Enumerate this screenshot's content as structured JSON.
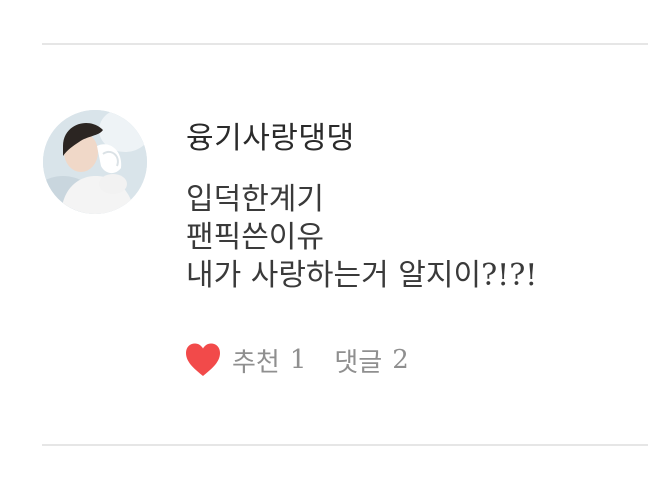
{
  "post": {
    "author": "융기사랑댕댕",
    "avatar_icon": "user-avatar-photo",
    "comment_lines": [
      "입덕한계기",
      "팬픽쓴이유",
      "내가 사랑하는거 알지이?!?!"
    ],
    "actions": {
      "like_icon": "heart-icon",
      "like_label": "추천",
      "like_count": "1",
      "reply_label": "댓글",
      "reply_count": "2"
    }
  },
  "colors": {
    "heart": "#f24a4a",
    "divider": "#e6e6e6",
    "muted_text": "#8f8f8f",
    "author_text": "#2a2a2a"
  }
}
